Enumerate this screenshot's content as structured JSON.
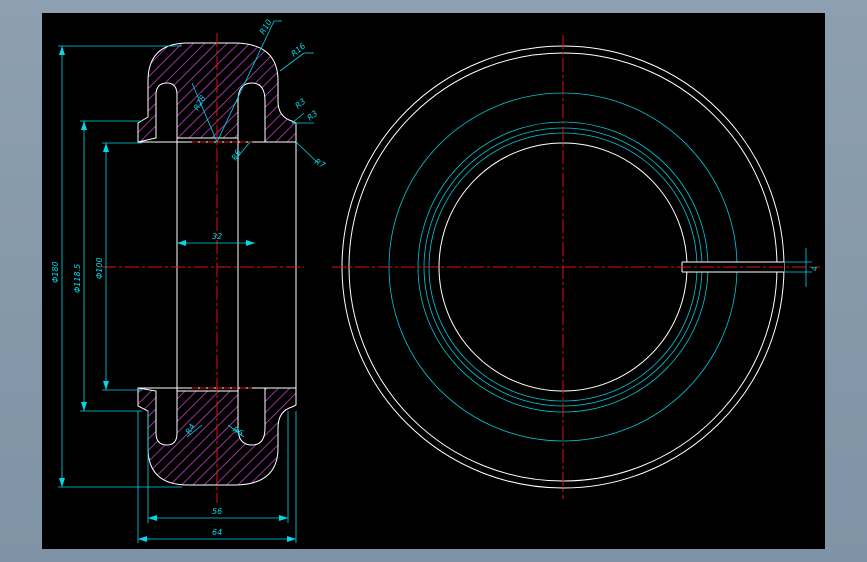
{
  "colors": {
    "background_outer": "#8497aa",
    "canvas": "#000000",
    "outline": "#ffffff",
    "dimension": "#00d8e8",
    "centerline": "#e01010",
    "hatch": "#c040c0"
  },
  "dimensions": {
    "r10": "R10",
    "r16": "R16",
    "r3a": "R3",
    "r3b": "R3",
    "r28": "R28",
    "r6_top": "R6",
    "r7": "R7",
    "width_inner": "32",
    "dia_180": "Φ180",
    "dia_118": "Φ118.5",
    "dia_100": "Φ100",
    "r4_bottom": "R4",
    "r6_bottom": "R6",
    "width_56": "56",
    "width_64": "64",
    "slot_width": "4"
  }
}
